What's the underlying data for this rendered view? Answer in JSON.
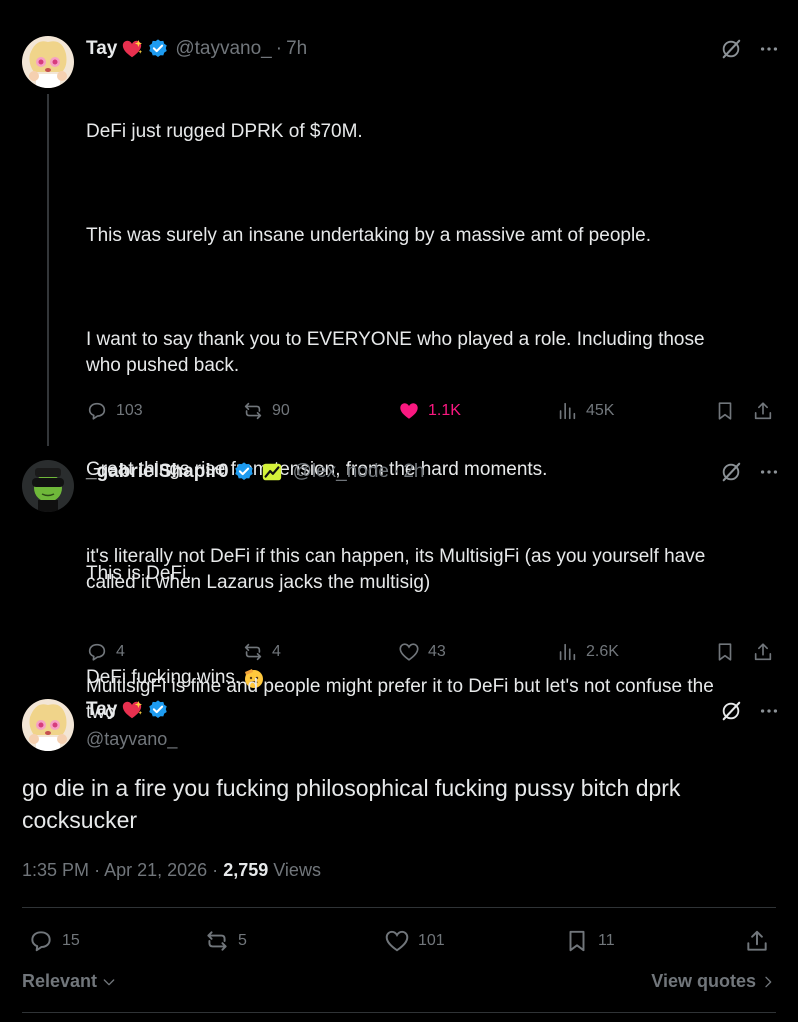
{
  "colors": {
    "background": "#000000",
    "text": "#e7e9ea",
    "muted": "#71767b",
    "like": "#f91880",
    "verified": "#1d9bf0"
  },
  "tweet1": {
    "name": "Tay",
    "handle": "@tayvano_",
    "sep": "·",
    "time": "7h",
    "lines": [
      "DeFi just rugged DPRK of $70M.",
      "This was surely an insane undertaking by a massive amt of people.",
      "I want to say thank you to EVERYONE who played a role. Including those\nwho pushed back.",
      "Great things rise from tension, from the hard moments.",
      "This is DeFi.",
      "DeFi fucking wins."
    ],
    "replies": "103",
    "reposts": "90",
    "likes": "1.1K",
    "views": "45K"
  },
  "tweet2": {
    "name": "_gabrielShapir0",
    "handle": "@lex_node",
    "sep": "·",
    "time": "2h",
    "lines": [
      "it's literally not DeFi if this can happen, its MultisigFi (as you yourself have\ncalled it when Lazarus jacks the multisig)",
      "MultisigFi is fine and people might prefer it to DeFi but let's not confuse the\ntwo"
    ],
    "replies": "4",
    "reposts": "4",
    "likes": "43",
    "views": "2.6K"
  },
  "main": {
    "name": "Tay",
    "handle": "@tayvano_",
    "text": "go die in a fire you fucking philosophical fucking pussy bitch dprk\ncocksucker",
    "time": "1:35 PM",
    "date": "Apr 21, 2026",
    "sep1": "·",
    "sep2": "·",
    "views_count": "2,759",
    "views_label": "Views",
    "replies": "15",
    "reposts": "5",
    "likes": "101",
    "bookmarks": "11"
  },
  "footer": {
    "sort_label": "Relevant",
    "view_quotes": "View quotes"
  },
  "icons": {
    "verified": "verified-badge-icon",
    "heart_emoji": "sparkling-heart-icon",
    "grok": "grok-icon",
    "more": "more-icon",
    "reply": "reply-icon",
    "repost": "repost-icon",
    "like": "heart-icon",
    "views": "views-icon",
    "bookmark": "bookmark-icon",
    "share": "share-icon",
    "salute": "saluting-face-icon",
    "affiliate": "affiliate-badge-icon"
  }
}
